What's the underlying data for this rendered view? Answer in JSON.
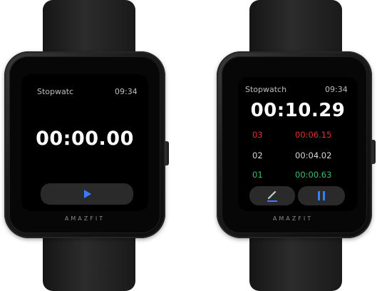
{
  "colors": {
    "accent_blue": "#3a7bff",
    "lap_red": "#e0302f",
    "lap_green": "#35c06a",
    "lap_white": "#d8d8d8"
  },
  "left_watch": {
    "app_title": "Stopwatc",
    "clock": "09:34",
    "elapsed": "00:00.00",
    "action_icon": "play-icon",
    "brand": "AMAZFIT"
  },
  "right_watch": {
    "app_title": "Stopwatch",
    "clock": "09:34",
    "elapsed": "00:10.29",
    "laps": [
      {
        "number": "03",
        "time": "00:06.15",
        "color": "red"
      },
      {
        "number": "02",
        "time": "00:04.02",
        "color": "white"
      },
      {
        "number": "01",
        "time": "00:00.63",
        "color": "green"
      }
    ],
    "left_action_icon": "pen-icon",
    "right_action_icon": "pause-icon",
    "brand": "AMAZFIT"
  }
}
